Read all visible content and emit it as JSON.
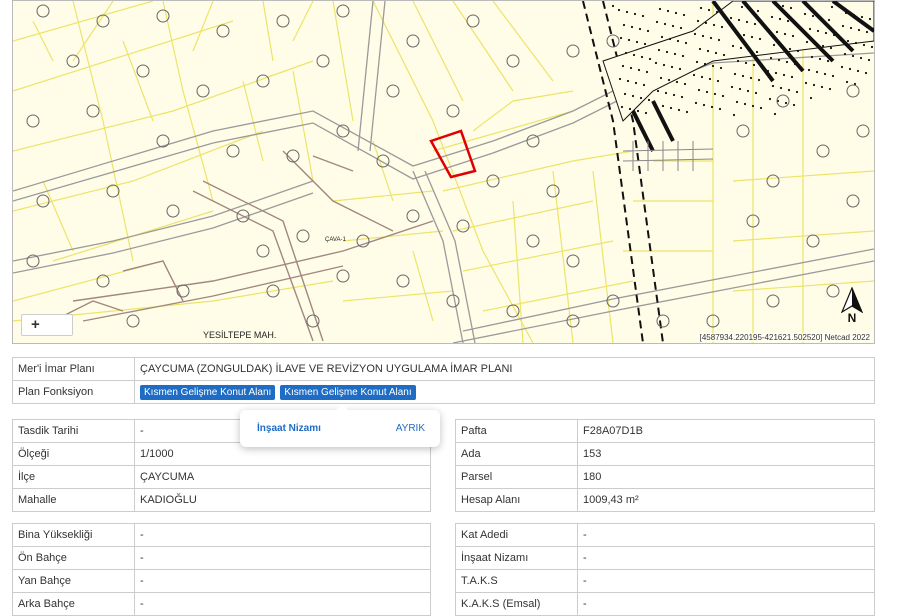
{
  "map": {
    "zoom_in_label": "+",
    "place_label": "YESİLTEPE MAH.",
    "road_label": "ÇAVA-1",
    "coords_text": "[4587934.220195-421621.502520] Netcad 2022",
    "north_label": "N",
    "colors": {
      "background": "#fffde8",
      "parcel_lines": "#ede36a",
      "roads": "#8a8a8a",
      "selected_parcel": "#e00000"
    }
  },
  "plan": {
    "rows": [
      {
        "label": "Mer'i İmar Planı",
        "value": "ÇAYCUMA (ZONGULDAK) İLAVE VE REVİZYON UYGULAMA İMAR PLANI"
      },
      {
        "label": "Plan Fonksiyon",
        "buttons": [
          "Kısmen Gelişme Konut Alanı",
          "Kısmen Gelişme Konut Alanı"
        ]
      }
    ]
  },
  "popup": {
    "key": "İnşaat Nizamı",
    "value": "AYRIK"
  },
  "left_info": [
    {
      "label": "Tasdik Tarihi",
      "value": "-"
    },
    {
      "label": "Ölçeği",
      "value": "1/1000"
    },
    {
      "label": "İlçe",
      "value": "ÇAYCUMA"
    },
    {
      "label": "Mahalle",
      "value": "KADIOĞLU"
    }
  ],
  "right_info": [
    {
      "label": "Pafta",
      "value": "F28A07D1B"
    },
    {
      "label": "Ada",
      "value": "153"
    },
    {
      "label": "Parsel",
      "value": "180"
    },
    {
      "label": "Hesap Alanı",
      "value": "1009,43 m²"
    }
  ],
  "left_build": [
    {
      "label": "Bina Yüksekliği",
      "value": "-"
    },
    {
      "label": "Ön Bahçe",
      "value": "-"
    },
    {
      "label": "Yan Bahçe",
      "value": "-"
    },
    {
      "label": "Arka Bahçe",
      "value": "-"
    }
  ],
  "right_build": [
    {
      "label": "Kat Adedi",
      "value": "-"
    },
    {
      "label": "İnşaat Nizamı",
      "value": "-"
    },
    {
      "label": "T.A.K.S",
      "value": "-"
    },
    {
      "label": "K.A.K.S (Emsal)",
      "value": "-"
    }
  ]
}
